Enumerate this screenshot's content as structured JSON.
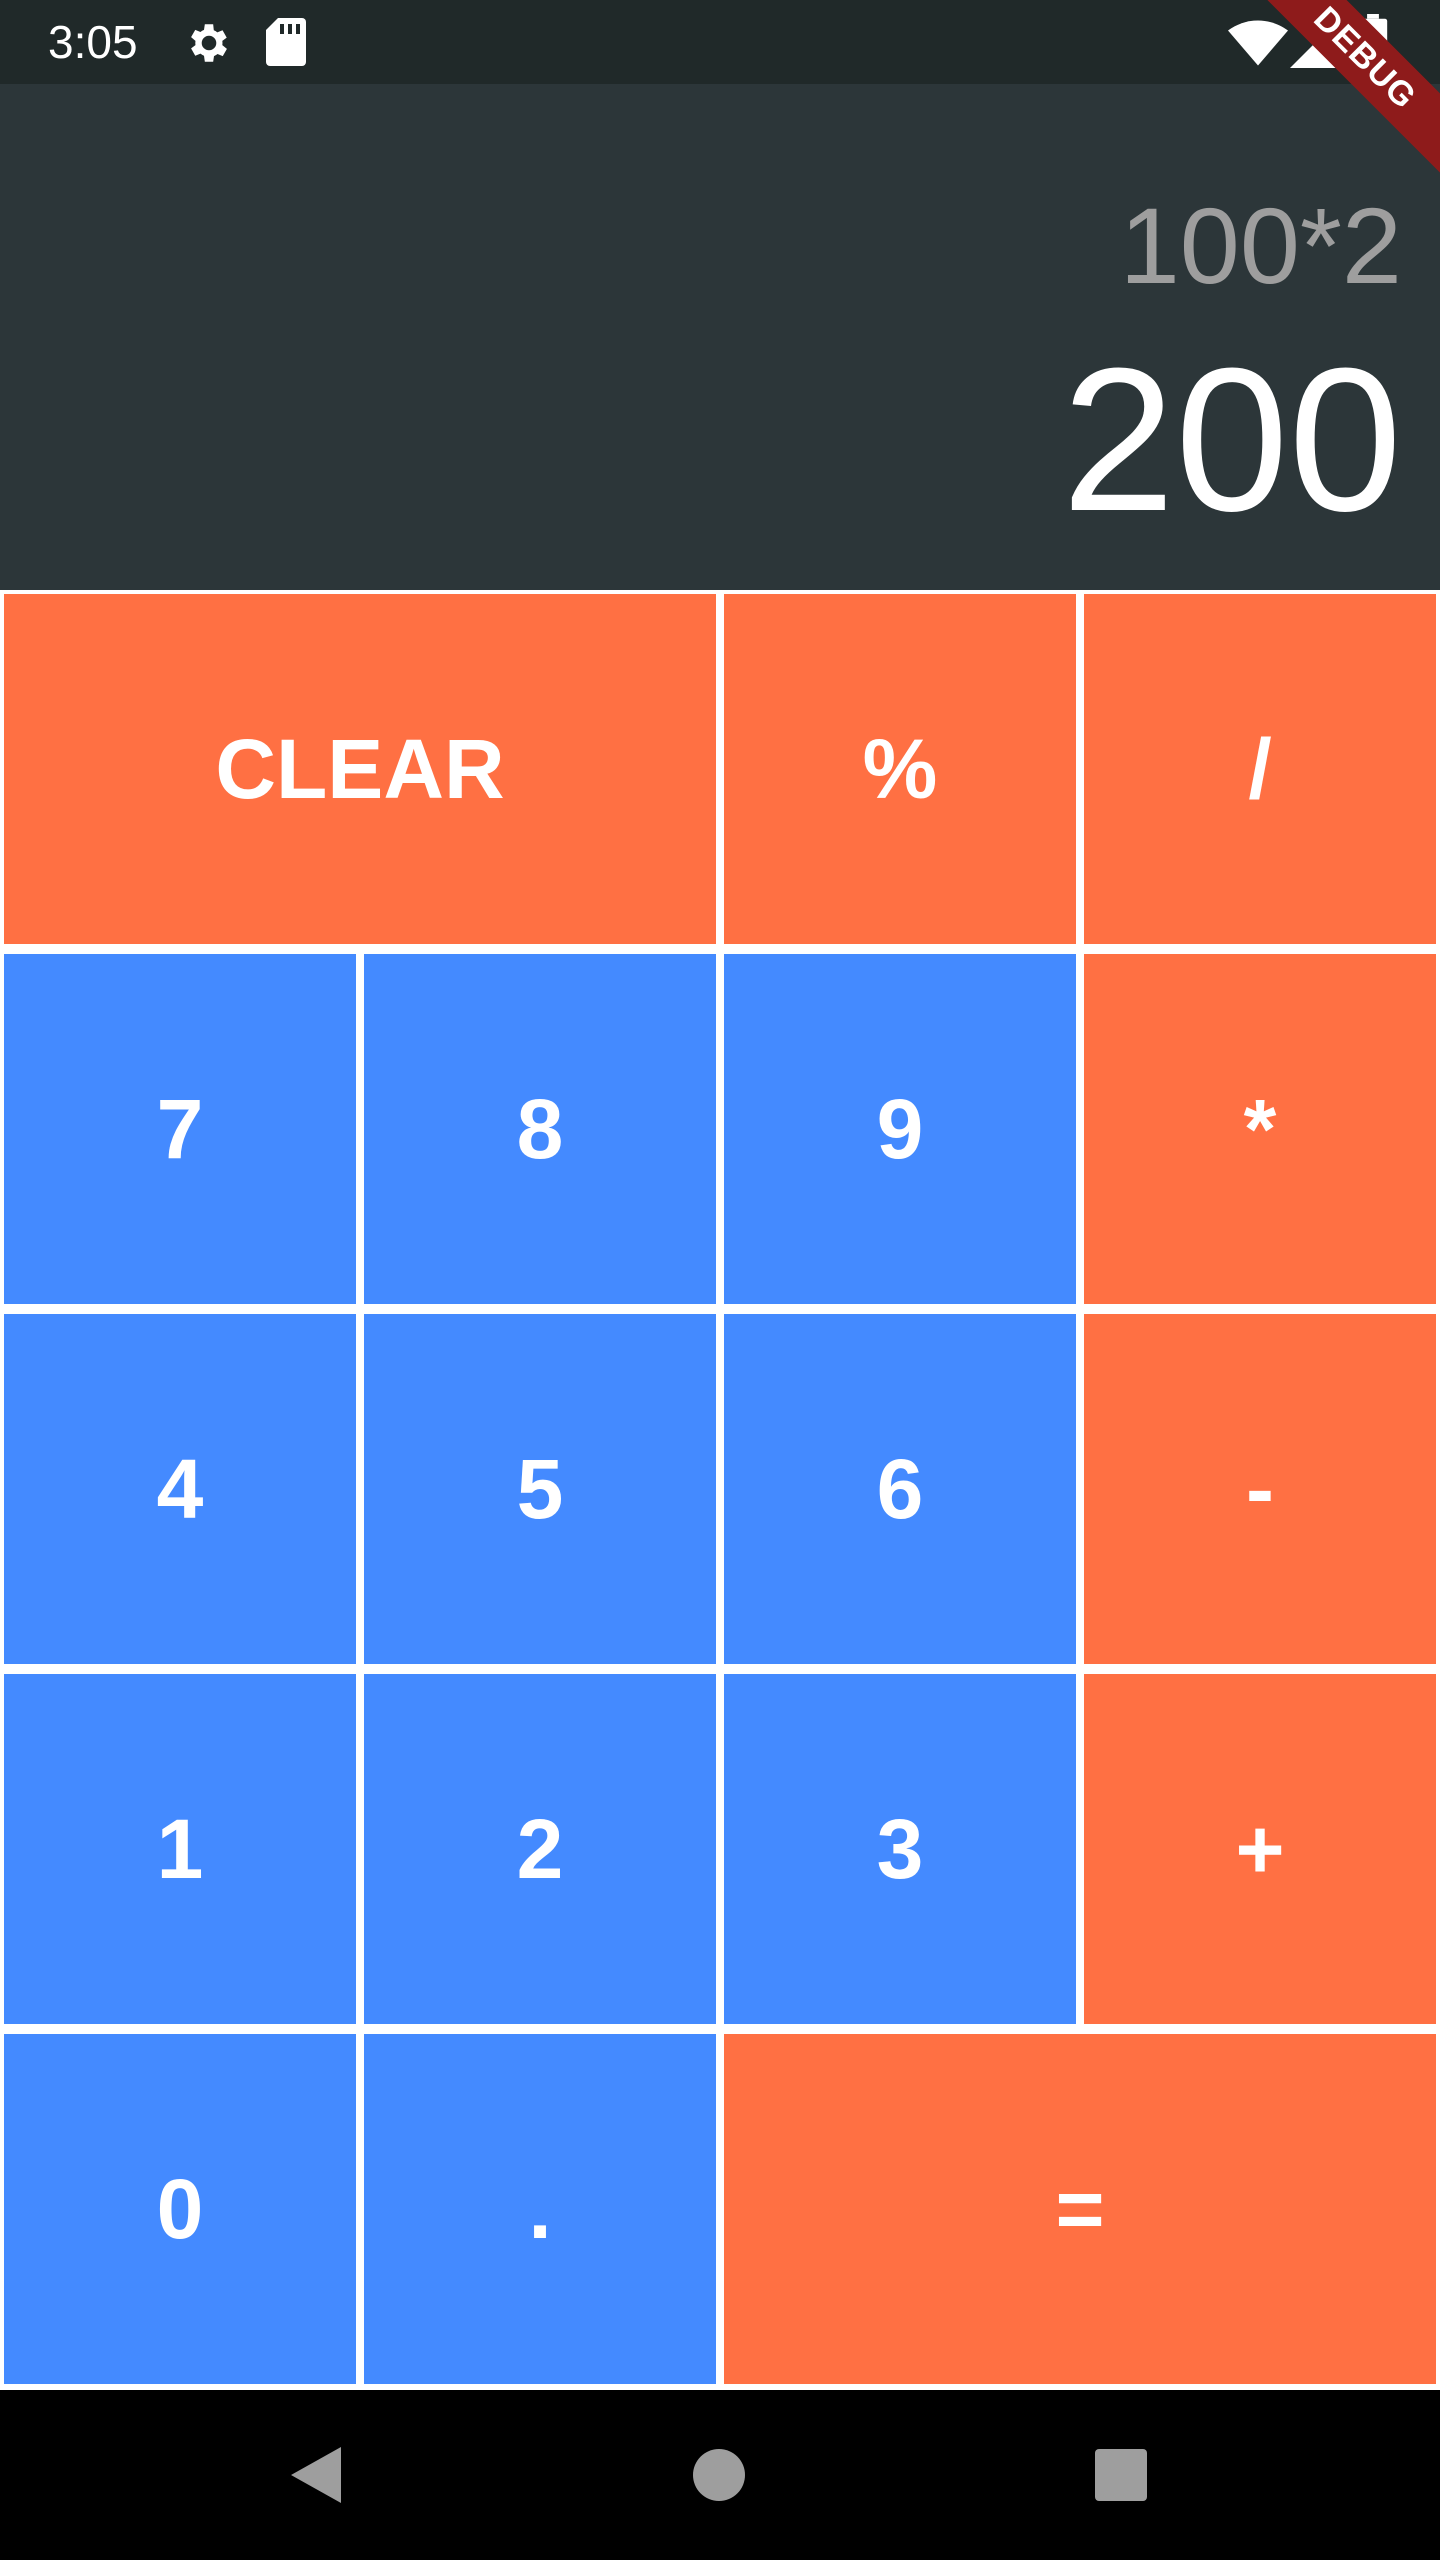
{
  "status_bar": {
    "time": "3:05",
    "left_icons": [
      "gear-icon",
      "sd-card-icon"
    ],
    "right_icons": [
      "wifi-icon",
      "signal-icon",
      "battery-icon"
    ]
  },
  "debug_banner": {
    "label": "DEBUG"
  },
  "display": {
    "expression": "100*2",
    "result": "200"
  },
  "keypad": {
    "row1": {
      "clear": "CLEAR",
      "percent": "%",
      "divide": "/"
    },
    "row2": {
      "seven": "7",
      "eight": "8",
      "nine": "9",
      "multiply": "*"
    },
    "row3": {
      "four": "4",
      "five": "5",
      "six": "6",
      "minus": "-"
    },
    "row4": {
      "one": "1",
      "two": "2",
      "three": "3",
      "plus": "+"
    },
    "row5": {
      "zero": "0",
      "dot": ".",
      "equals": "="
    }
  },
  "nav_bar": {
    "icons": [
      "back-icon",
      "home-icon",
      "recents-icon"
    ]
  },
  "colors": {
    "display_bg": "#2c3639",
    "number_key": "#448aff",
    "operator_key": "#ff7043",
    "expression_text": "#9e9e9e",
    "result_text": "#ffffff"
  }
}
